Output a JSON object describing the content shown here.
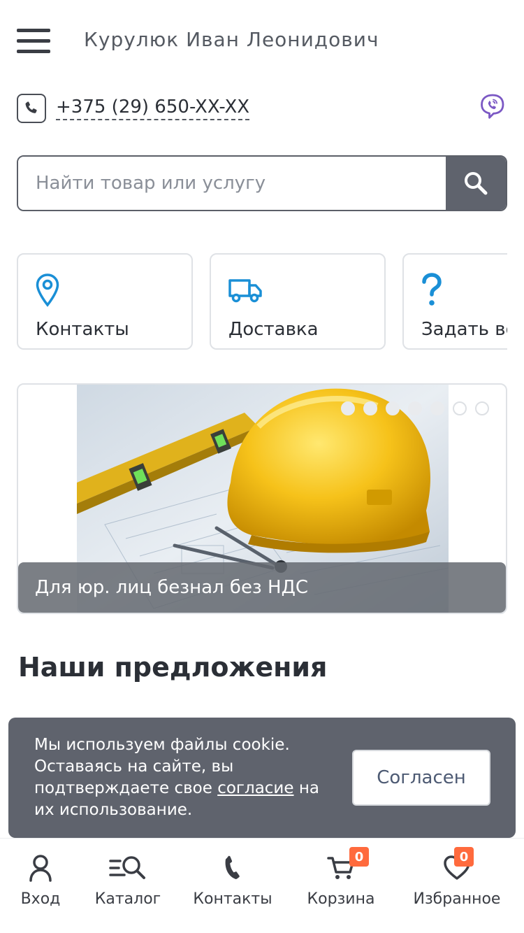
{
  "header": {
    "shop_name": "Курулюк Иван Леонидович"
  },
  "contact": {
    "phone": "+375 (29) 650-XX-XX"
  },
  "search": {
    "placeholder": "Найти товар или услугу"
  },
  "tiles": [
    {
      "label": "Контакты",
      "icon": "location-pin-icon"
    },
    {
      "label": "Доставка",
      "icon": "truck-icon"
    },
    {
      "label": "Задать вопрос",
      "icon": "question-icon"
    }
  ],
  "banner": {
    "caption": "Для юр. лиц безнал без НДС",
    "slides_count": 7,
    "active_slides": 5
  },
  "section": {
    "title": "Наши предложения"
  },
  "cookie": {
    "text_before": "Мы используем файлы cookie. Оставаясь на сайте, вы подтверждаете свое ",
    "link": "согласие",
    "text_after": " на их использование.",
    "button": "Согласен"
  },
  "bottom_nav": [
    {
      "label": "Вход",
      "icon": "user-icon"
    },
    {
      "label": "Каталог",
      "icon": "catalog-search-icon"
    },
    {
      "label": "Контакты",
      "icon": "phone-icon"
    },
    {
      "label": "Корзина",
      "icon": "cart-icon",
      "badge": "0"
    },
    {
      "label": "Избранное",
      "icon": "heart-icon",
      "badge": "0"
    }
  ],
  "colors": {
    "accent_blue": "#1a8fd6",
    "dark_gray": "#5f636d",
    "badge_orange": "#ff6a3d",
    "viber_purple": "#7b58c4"
  }
}
